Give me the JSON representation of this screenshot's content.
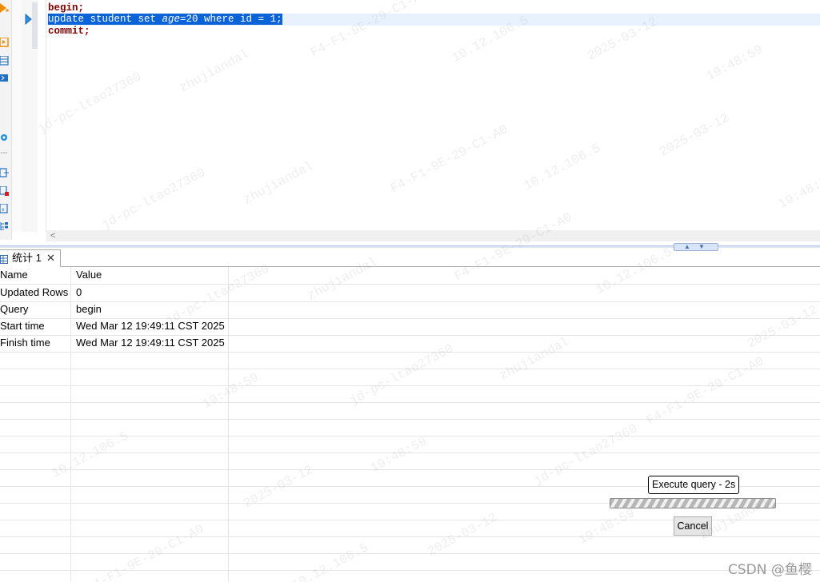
{
  "editor": {
    "lines": {
      "line1": "begin;",
      "line2_prefix": "update student set ",
      "line2_italic": "age",
      "line2_suffix": "=20 where id = 1;",
      "line3": "commit;"
    },
    "scroll_left_glyph": "<"
  },
  "results": {
    "tab_label": "统计 1",
    "tab_close_glyph": "✕",
    "columns": [
      "Name",
      "Value"
    ],
    "rows": [
      {
        "name": "Updated Rows",
        "value": "0"
      },
      {
        "name": "Query",
        "value": "begin"
      },
      {
        "name": "Start time",
        "value": "Wed Mar 12 19:49:11 CST 2025"
      },
      {
        "name": "Finish time",
        "value": "Wed Mar 12 19:49:11 CST 2025"
      }
    ]
  },
  "progress": {
    "label": "Execute query - 2s",
    "cancel_label": "Cancel"
  },
  "watermark": {
    "texts": [
      "jd-pc-ltao27360",
      "zhujiandal",
      "F4-F1-9E-29-C1-A0",
      "10.12.106.5",
      "2025-03-12",
      "19:48:59"
    ],
    "credit": "CSDN @鱼樱"
  },
  "colors": {
    "selection": "#0a64d8",
    "keyword": "#7f0000",
    "current_line": "#e8f2fe",
    "toolbar_icon_orange": "#f08c00",
    "toolbar_icon_blue": "#1f6fc5"
  }
}
